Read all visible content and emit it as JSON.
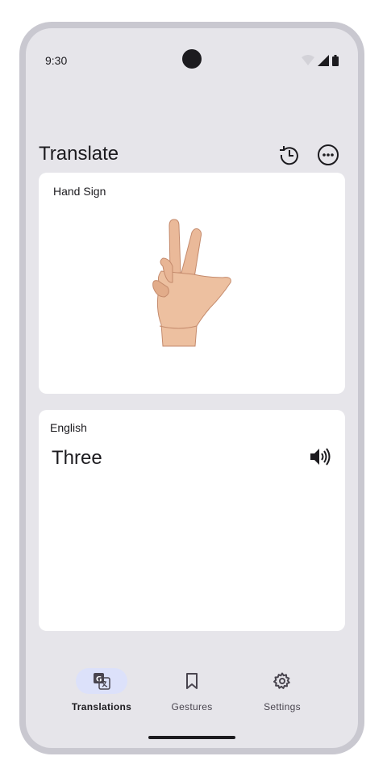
{
  "status_bar": {
    "time": "9:30"
  },
  "header": {
    "title": "Translate",
    "history_icon": "history-icon",
    "more_icon": "more-horizontal-icon"
  },
  "input_card": {
    "label": "Hand Sign",
    "image": "hand-sign-three"
  },
  "output_card": {
    "language": "English",
    "text": "Three",
    "speaker_icon": "speaker-icon"
  },
  "nav": {
    "items": [
      {
        "label": "Translations",
        "icon": "translate-icon",
        "active": true
      },
      {
        "label": "Gestures",
        "icon": "bookmark-icon",
        "active": false
      },
      {
        "label": "Settings",
        "icon": "gear-icon",
        "active": false
      }
    ]
  },
  "colors": {
    "background": "#e6e5ea",
    "card": "#ffffff",
    "active_pill": "#dce1fa",
    "frame": "#c9c8d0"
  }
}
